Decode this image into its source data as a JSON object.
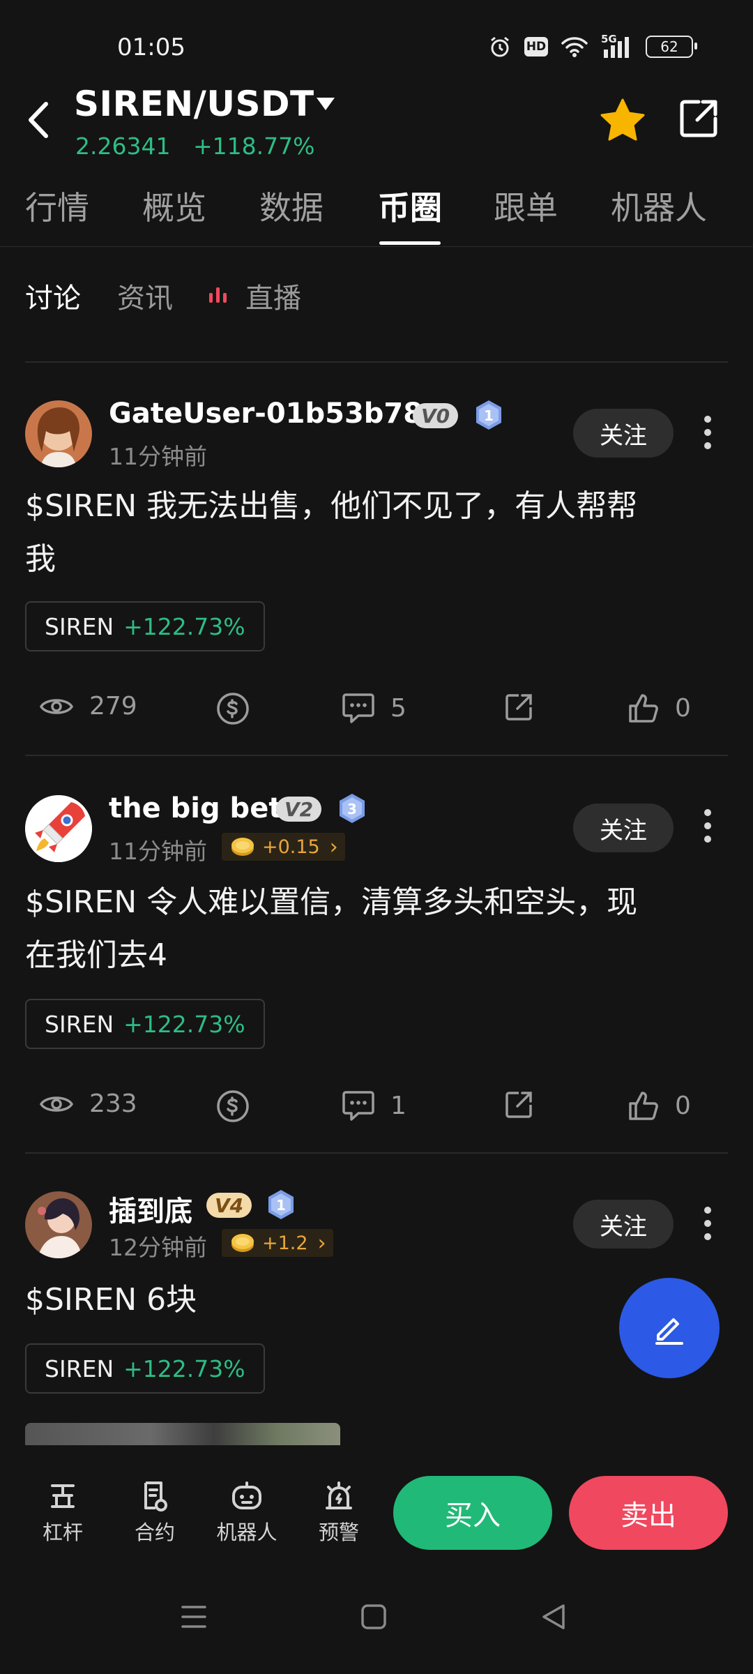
{
  "status": {
    "time": "01:05",
    "battery": "62",
    "hd": "HD",
    "network": "5G"
  },
  "header": {
    "pair": "SIREN/USDT",
    "price": "2.26341",
    "change": "+118.77%"
  },
  "tabs": [
    {
      "label": "行情"
    },
    {
      "label": "概览"
    },
    {
      "label": "数据"
    },
    {
      "label": "币圈"
    },
    {
      "label": "跟单"
    },
    {
      "label": "机器人"
    }
  ],
  "subtabs": {
    "discuss": "讨论",
    "news": "资讯",
    "live": "直播"
  },
  "posts": [
    {
      "user": "GateUser-01b53b78",
      "vip": "V0",
      "level": "1",
      "time": "11分钟前",
      "reward": "",
      "follow": "关注",
      "line1": "$SIREN  我无法出售，他们不见了，有人帮帮",
      "line2": "我",
      "tag_symbol": "SIREN",
      "tag_change": "+122.73%",
      "views": "279",
      "comments": "5",
      "likes": "0"
    },
    {
      "user": "the big bet",
      "vip": "V2",
      "level": "3",
      "time": "11分钟前",
      "reward": "+0.15",
      "follow": "关注",
      "line1": "$SIREN  令人难以置信，清算多头和空头，现",
      "line2": "在我们去4",
      "tag_symbol": "SIREN",
      "tag_change": "+122.73%",
      "views": "233",
      "comments": "1",
      "likes": "0"
    },
    {
      "user": "插到底",
      "vip": "V4",
      "level": "1",
      "time": "12分钟前",
      "reward": "+1.2",
      "follow": "关注",
      "line1": "$SIREN 6块",
      "line2": "",
      "tag_symbol": "SIREN",
      "tag_change": "+122.73%"
    }
  ],
  "toolbar": {
    "leverage": "杠杆",
    "contract": "合约",
    "robot": "机器人",
    "alert": "预警",
    "buy": "买入",
    "sell": "卖出"
  },
  "colors": {
    "up": "#2ebd85",
    "buy": "#21b978",
    "sell": "#f0485f",
    "fab": "#2c59e6",
    "star": "#f7b500"
  }
}
